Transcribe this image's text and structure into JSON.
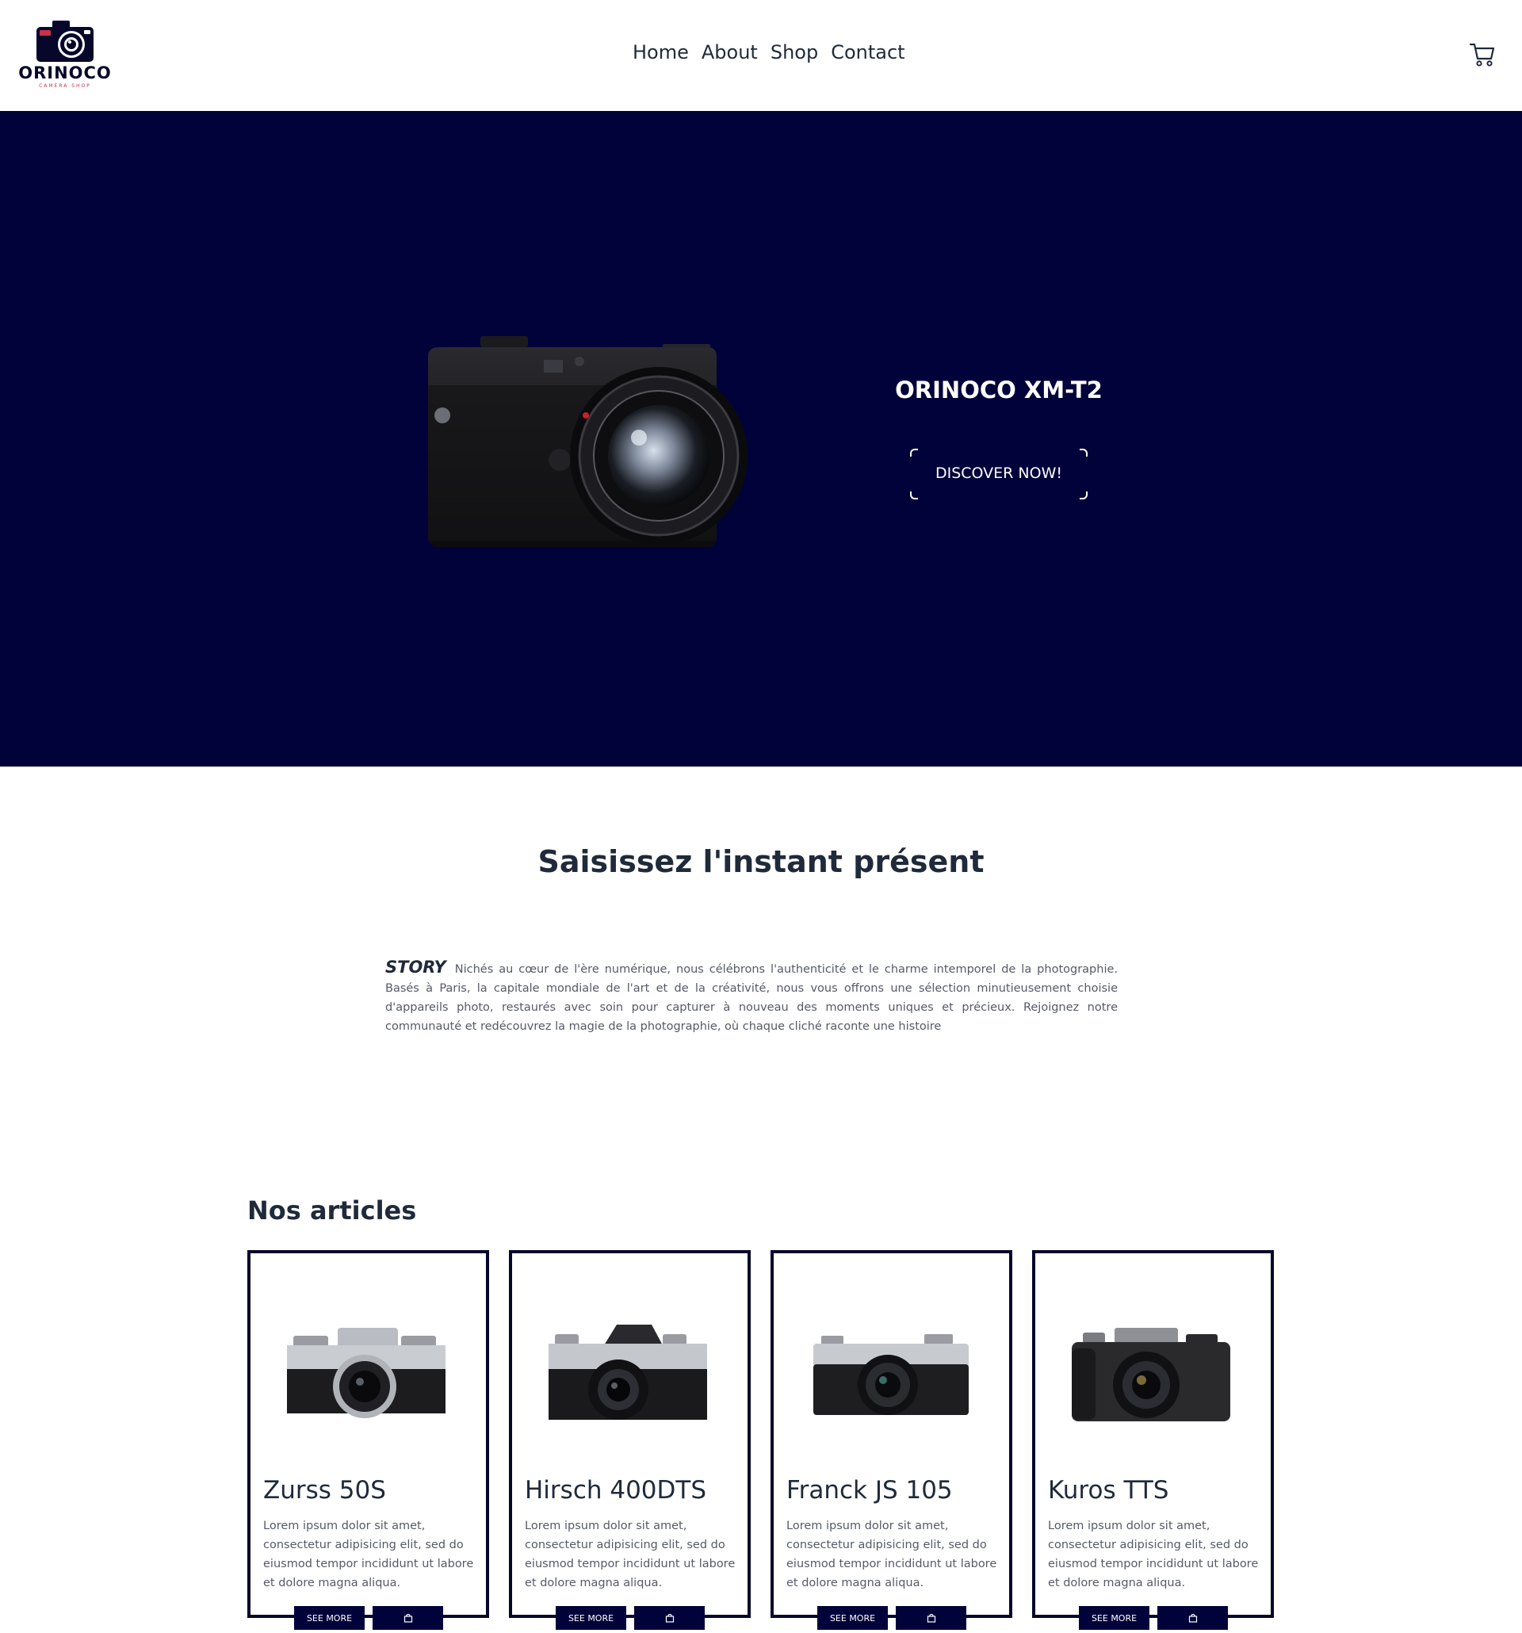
{
  "header": {
    "logo": {
      "name": "ORINOCO",
      "subtitle": "CAMERA SHOP"
    },
    "nav": [
      {
        "label": "Home"
      },
      {
        "label": "About"
      },
      {
        "label": "Shop"
      },
      {
        "label": "Contact"
      }
    ],
    "cart_icon": "shopping-cart-icon"
  },
  "hero": {
    "title": "ORINOCO XM-T2",
    "button_label": "DISCOVER NOW!",
    "background_color": "#02023a"
  },
  "intro": {
    "title": "Saisissez l'instant présent",
    "story_label": "STORY",
    "story_text": "Nichés au cœur de l'ère numérique, nous célébrons l'authenticité et le charme intemporel de la photographie. Basés à Paris, la capitale mondiale de l'art et de la créativité, nous vous offrons une sélection minutieusement choisie d'appareils photo, restaurés avec soin pour capturer à nouveau des moments uniques et précieux. Rejoignez notre communauté et redécouvrez la magie de la photographie, où chaque cliché raconte une histoire"
  },
  "articles": {
    "title": "Nos articles",
    "items": [
      {
        "name": "Zurss 50S",
        "description": "Lorem ipsum dolor sit amet, consectetur adipisicing elit, sed do eiusmod tempor incididunt ut labore et dolore magna aliqua.",
        "see_more": "SEE MORE"
      },
      {
        "name": "Hirsch 400DTS",
        "description": "Lorem ipsum dolor sit amet, consectetur adipisicing elit, sed do eiusmod tempor incididunt ut labore et dolore magna aliqua.",
        "see_more": "SEE MORE"
      },
      {
        "name": "Franck JS 105",
        "description": "Lorem ipsum dolor sit amet, consectetur adipisicing elit, sed do eiusmod tempor incididunt ut labore et dolore magna aliqua.",
        "see_more": "SEE MORE"
      },
      {
        "name": "Kuros TTS",
        "description": "Lorem ipsum dolor sit amet, consectetur adipisicing elit, sed do eiusmod tempor incididunt ut labore et dolore magna aliqua.",
        "see_more": "SEE MORE"
      }
    ]
  },
  "colors": {
    "brand_navy": "#02023a",
    "text": "#1f2a3a",
    "muted_text": "#555a66",
    "logo_accent": "#c8324a"
  }
}
